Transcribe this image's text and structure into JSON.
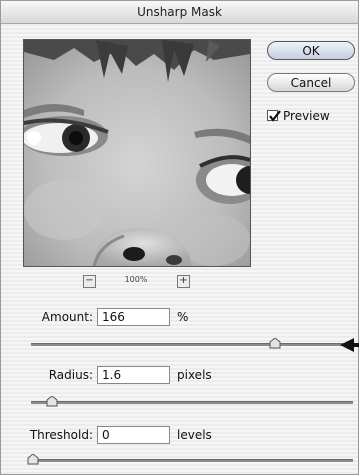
{
  "dialog": {
    "title": "Unsharp Mask"
  },
  "preview": {
    "zoom_out_icon": "minus-icon",
    "zoom_in_icon": "plus-icon",
    "zoom_level": "100%"
  },
  "buttons": {
    "ok": "OK",
    "cancel": "Cancel"
  },
  "preview_toggle": {
    "label": "Preview",
    "checked": true
  },
  "amount": {
    "label": "Amount:",
    "value": "166",
    "unit": "%",
    "slider_fraction": 0.78
  },
  "radius": {
    "label": "Radius:",
    "value": "1.6",
    "unit": "pixels",
    "slider_fraction": 0.06
  },
  "threshold": {
    "label": "Threshold:",
    "value": "0",
    "unit": "levels",
    "slider_fraction": 0.0
  },
  "colors": {
    "arrow": "#111111",
    "default_button": "#c6cfdc"
  }
}
